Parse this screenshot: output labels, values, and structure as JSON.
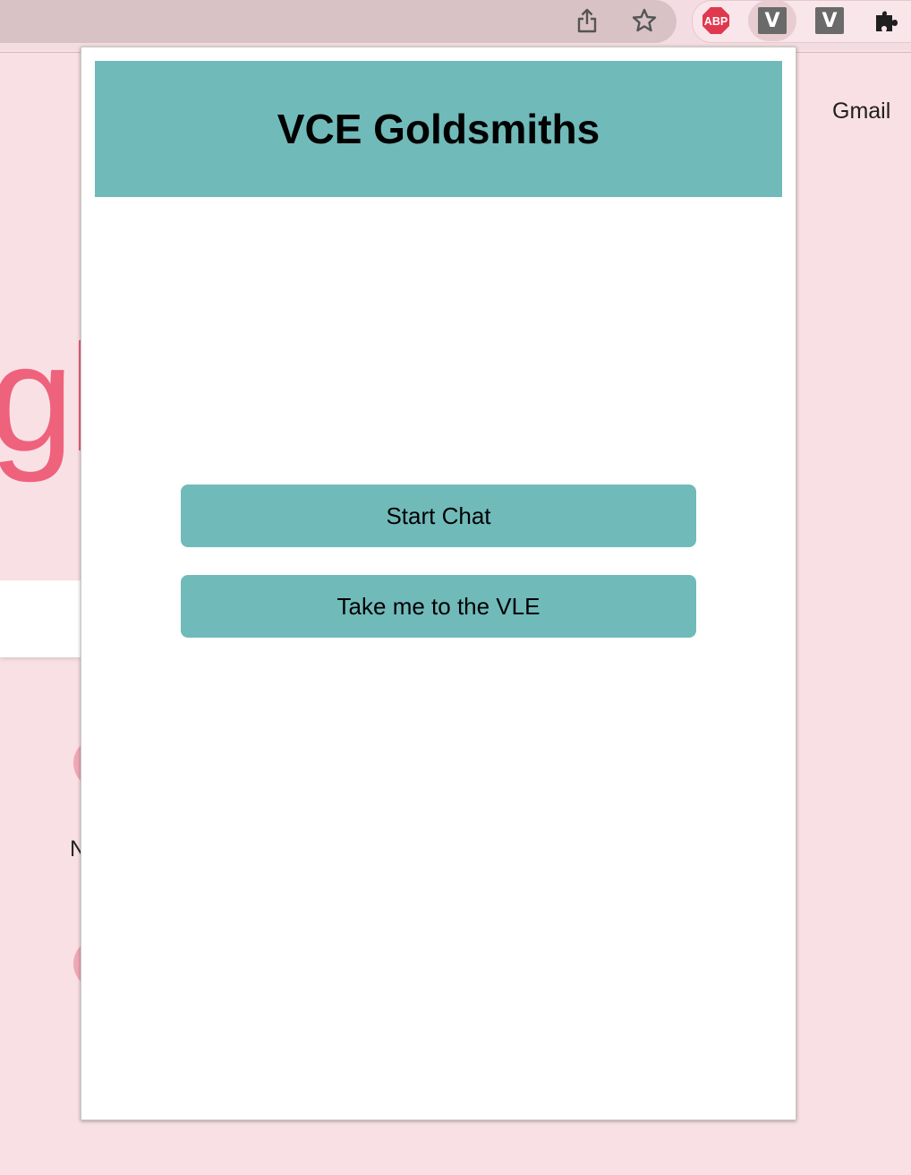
{
  "browser": {
    "extensions": {
      "abp_label": "ABP",
      "ext1_label": "V",
      "ext2_label": "V"
    }
  },
  "background_page": {
    "gmail_link": "Gmail",
    "logo_fragment": "gl",
    "shortcut_label_fragment": "N",
    "colors": {
      "page_bg": "#f9e0e5",
      "logo": "#ee627c"
    }
  },
  "popup": {
    "title": "VCE Goldsmiths",
    "buttons": {
      "start_chat": "Start Chat",
      "vle": "Take me to the VLE"
    },
    "colors": {
      "accent": "#71baba",
      "background": "#ffffff"
    }
  }
}
